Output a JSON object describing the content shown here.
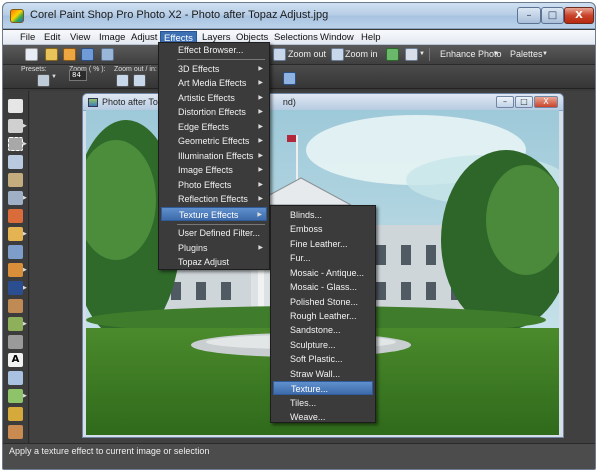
{
  "window": {
    "title": "Corel Paint Shop Pro Photo X2 - Photo after Topaz Adjust.jpg",
    "controls": {
      "minimize": "–",
      "maximize": "□",
      "close": "X"
    }
  },
  "menubar": {
    "items": [
      "File",
      "Edit",
      "View",
      "Image",
      "Adjust",
      "Effects",
      "Layers",
      "Objects",
      "Selections",
      "Window",
      "Help"
    ],
    "active": "Effects"
  },
  "toolbar": {
    "zoom_out": "Zoom out",
    "zoom_in": "Zoom in",
    "enhance_photo": "Enhance Photo",
    "palettes": "Palettes"
  },
  "options": {
    "presets_label": "Presets:",
    "zoom_label": "Zoom ( % ):",
    "zoom_value": "84",
    "zoom_outin_label": "Zoom out / in:"
  },
  "document": {
    "title_prefix": "Photo after Topa",
    "title_suffix": "nd)"
  },
  "effects_menu": {
    "items": [
      {
        "label": "Effect Browser...",
        "submenu": false
      },
      {
        "label": "3D Effects",
        "submenu": true
      },
      {
        "label": "Art Media Effects",
        "submenu": true
      },
      {
        "label": "Artistic Effects",
        "submenu": true
      },
      {
        "label": "Distortion Effects",
        "submenu": true
      },
      {
        "label": "Edge Effects",
        "submenu": true
      },
      {
        "label": "Geometric Effects",
        "submenu": true
      },
      {
        "label": "Illumination Effects",
        "submenu": true
      },
      {
        "label": "Image Effects",
        "submenu": true
      },
      {
        "label": "Photo Effects",
        "submenu": true
      },
      {
        "label": "Reflection Effects",
        "submenu": true
      },
      {
        "label": "Texture Effects",
        "submenu": true
      },
      {
        "label": "User Defined Filter...",
        "submenu": false
      },
      {
        "label": "Plugins",
        "submenu": true
      },
      {
        "label": "Topaz Adjust",
        "submenu": false
      }
    ],
    "highlighted": "Texture Effects"
  },
  "texture_menu": {
    "items": [
      "Blinds...",
      "Emboss",
      "Fine Leather...",
      "Fur...",
      "Mosaic - Antique...",
      "Mosaic - Glass...",
      "Polished Stone...",
      "Rough Leather...",
      "Sandstone...",
      "Sculpture...",
      "Soft Plastic...",
      "Straw Wall...",
      "Texture...",
      "Tiles...",
      "Weave..."
    ],
    "highlighted": "Texture..."
  },
  "status": {
    "text": "Apply a texture effect to current image or selection"
  },
  "colors": {
    "menu_highlight": "#3d6fb3",
    "dropdown_bg": "#3b3b3b",
    "workspace_bg": "#404040"
  }
}
